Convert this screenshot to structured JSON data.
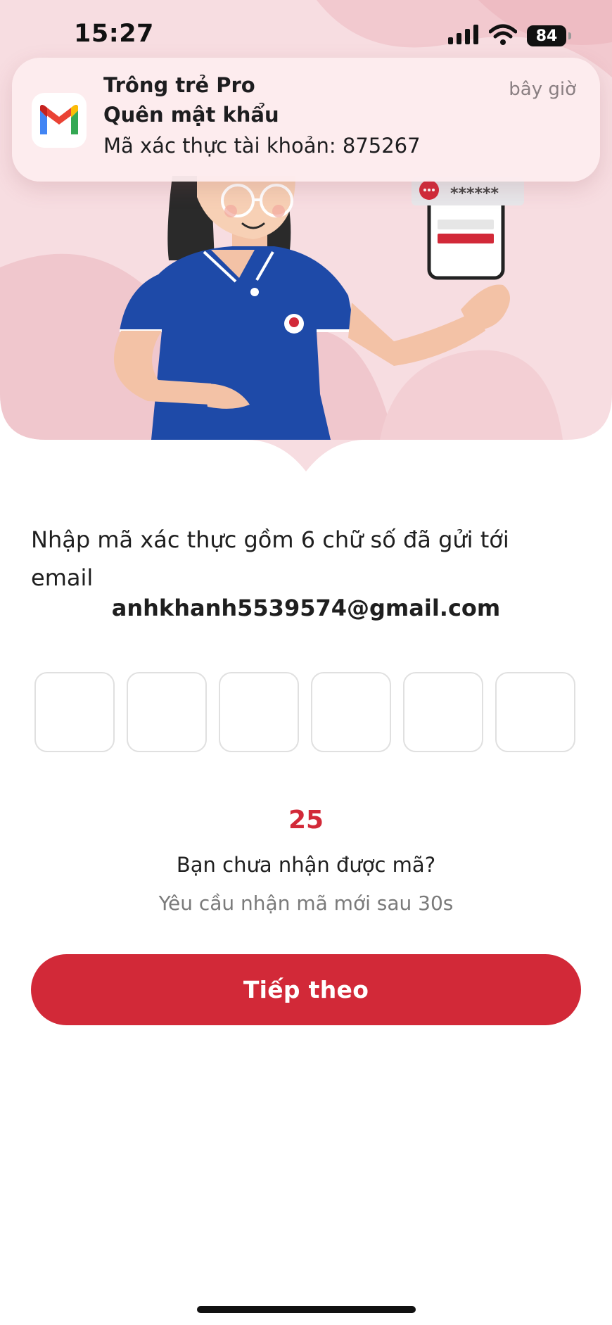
{
  "status_bar": {
    "time": "15:27",
    "battery": "84",
    "icons": [
      "cellular-signal-icon",
      "wifi-icon",
      "battery-icon"
    ]
  },
  "notification": {
    "app_icon": "gmail-icon",
    "app_name": "Trông trẻ Pro",
    "title": "Quên mật khẩu",
    "body": "Mã xác thực tài khoản: 875267",
    "time": "bây giờ"
  },
  "illustration": {
    "bubble_text": "******"
  },
  "content": {
    "instruction": "Nhập mã xác thực gồm 6 chữ số đã gửi tới email",
    "email": "anhkhanh5539574@gmail.com",
    "otp_digits": [
      "",
      "",
      "",
      "",
      "",
      ""
    ],
    "countdown": "25",
    "not_received": "Bạn chưa nhận được mã?",
    "resend_note": "Yêu cầu nhận mã mới sau 30s"
  },
  "actions": {
    "next_label": "Tiếp theo"
  },
  "colors": {
    "primary": "#d22938",
    "hero_background": "#f7dde1",
    "shirt": "#1e4aa8"
  }
}
